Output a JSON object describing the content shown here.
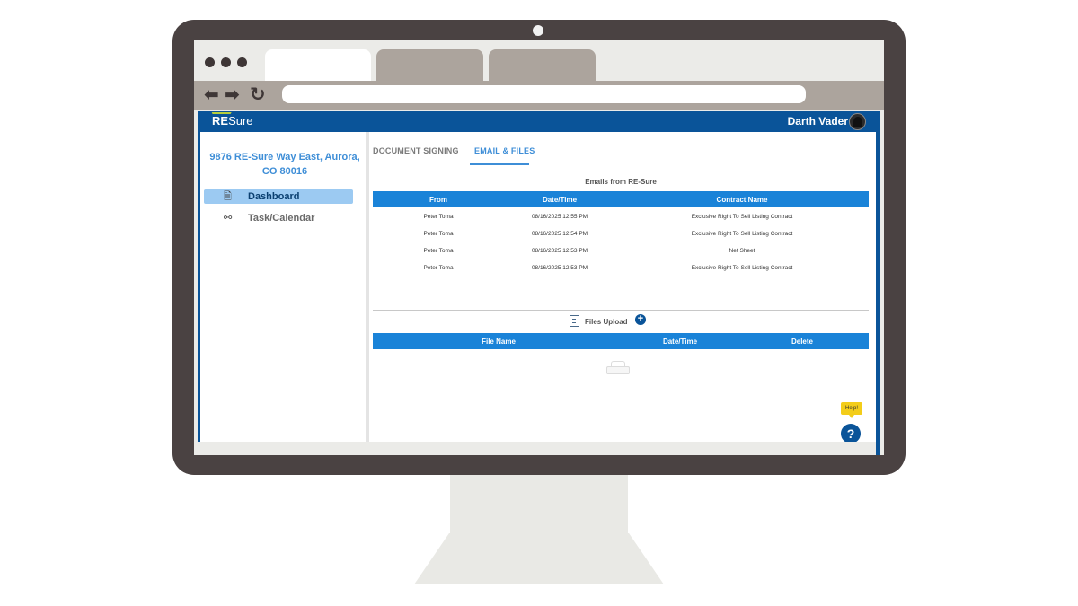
{
  "brand": {
    "logo_prefix": "RE",
    "logo_suffix": "Sure",
    "header_color": "#0a5499",
    "accent_color": "#1a83d8"
  },
  "user": {
    "name": "Darth Vader"
  },
  "sidebar": {
    "address": "9876 RE-Sure Way East, Aurora, CO 80016",
    "items": [
      {
        "label": "Dashboard",
        "icon": "document-icon",
        "active": true
      },
      {
        "label": "Task/Calendar",
        "icon": "hierarchy-icon",
        "active": false
      }
    ]
  },
  "tabs": [
    {
      "label": "DOCUMENT SIGNING",
      "active": false
    },
    {
      "label": "EMAIL & FILES",
      "active": true
    }
  ],
  "emails": {
    "title": "Emails from RE-Sure",
    "columns": [
      "From",
      "Date/Time",
      "Contract Name"
    ],
    "rows": [
      {
        "from": "Peter Toma",
        "datetime": "08/16/2025 12:55 PM",
        "contract": "Exclusive Right To Sell Listing Contract"
      },
      {
        "from": "Peter Toma",
        "datetime": "08/16/2025 12:54 PM",
        "contract": "Exclusive Right To Sell Listing Contract"
      },
      {
        "from": "Peter Toma",
        "datetime": "08/16/2025 12:53 PM",
        "contract": "Net Sheet"
      },
      {
        "from": "Peter Toma",
        "datetime": "08/16/2025 12:53 PM",
        "contract": "Exclusive Right To Sell Listing Contract"
      }
    ]
  },
  "files": {
    "title": "Files Upload",
    "add_icon": "+",
    "columns": [
      "File Name",
      "Date/Time",
      "Delete"
    ]
  },
  "help": {
    "tooltip": "Help!",
    "icon": "?"
  }
}
